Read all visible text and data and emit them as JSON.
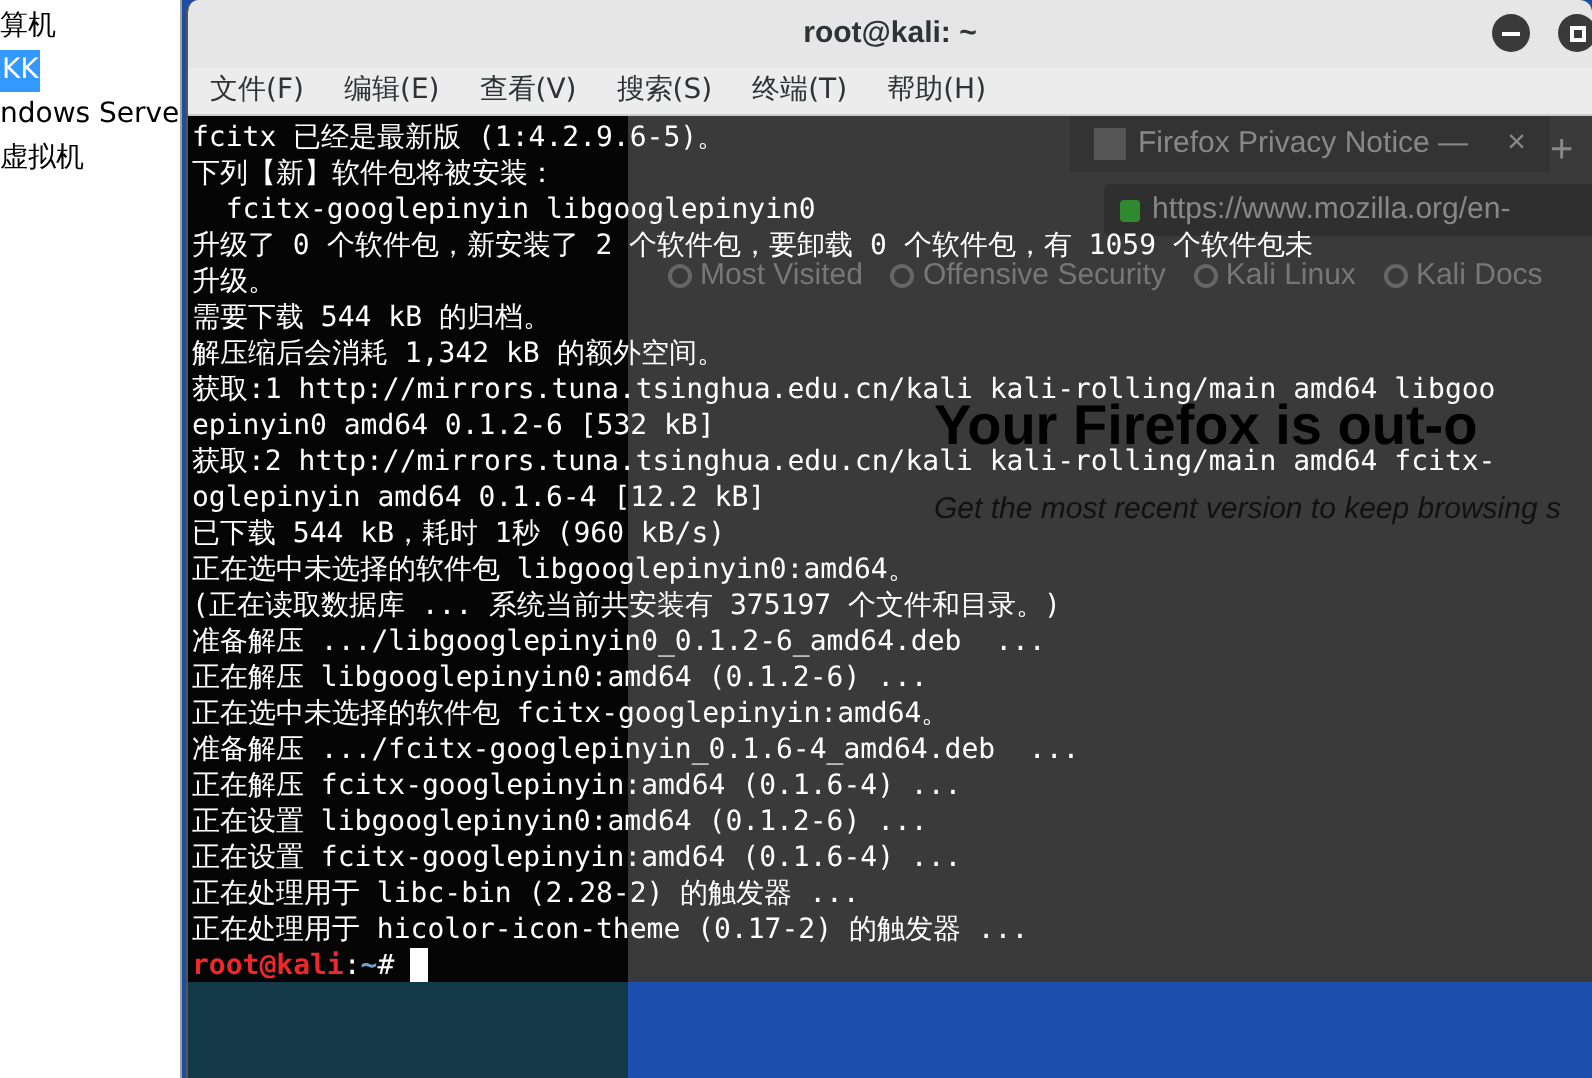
{
  "sidebar": {
    "items": [
      {
        "label": "算机",
        "selected": false
      },
      {
        "label": "KK",
        "selected": true
      },
      {
        "label": "ndows Serve",
        "selected": false
      },
      {
        "label": "虚拟机",
        "selected": false
      }
    ]
  },
  "background_browser": {
    "tab": "Firefox Privacy Notice —",
    "tab_close": "×",
    "new_tab": "+",
    "address": "https://www.mozilla.org/en-",
    "bookmarks": [
      "Most Visited",
      "Offensive Security",
      "Kali Linux",
      "Kali Docs"
    ],
    "heading": "Your Firefox is out-o",
    "subheading": "Get the most recent version to keep browsing s"
  },
  "terminal": {
    "title": "root@kali: ~",
    "menu": [
      "文件(F)",
      "编辑(E)",
      "查看(V)",
      "搜索(S)",
      "终端(T)",
      "帮助(H)"
    ],
    "lines": [
      "fcitx 已经是最新版 (1:4.2.9.6-5)。",
      "下列【新】软件包将被安装：",
      "  fcitx-googlepinyin libgooglepinyin0",
      "升级了 0 个软件包，新安装了 2 个软件包，要卸载 0 个软件包，有 1059 个软件包未",
      "升级。",
      "需要下载 544 kB 的归档。",
      "解压缩后会消耗 1,342 kB 的额外空间。",
      "获取:1 http://mirrors.tuna.tsinghua.edu.cn/kali kali-rolling/main amd64 libgoo",
      "epinyin0 amd64 0.1.2-6 [532 kB]",
      "获取:2 http://mirrors.tuna.tsinghua.edu.cn/kali kali-rolling/main amd64 fcitx-",
      "oglepinyin amd64 0.1.6-4 [12.2 kB]",
      "已下载 544 kB，耗时 1秒 (960 kB/s)",
      "正在选中未选择的软件包 libgooglepinyin0:amd64。",
      "(正在读取数据库 ... 系统当前共安装有 375197 个文件和目录。)",
      "准备解压 .../libgooglepinyin0_0.1.2-6_amd64.deb  ...",
      "正在解压 libgooglepinyin0:amd64 (0.1.2-6) ...",
      "正在选中未选择的软件包 fcitx-googlepinyin:amd64。",
      "准备解压 .../fcitx-googlepinyin_0.1.6-4_amd64.deb  ...",
      "正在解压 fcitx-googlepinyin:amd64 (0.1.6-4) ...",
      "正在设置 libgooglepinyin0:amd64 (0.1.2-6) ...",
      "正在设置 fcitx-googlepinyin:amd64 (0.1.6-4) ...",
      "正在处理用于 libc-bin (2.28-2) 的触发器 ...",
      "正在处理用于 hicolor-icon-theme (0.17-2) 的触发器 ..."
    ],
    "prompt": {
      "user_host": "root@kali",
      "separator": ":",
      "path": "~",
      "symbol": "#"
    }
  }
}
